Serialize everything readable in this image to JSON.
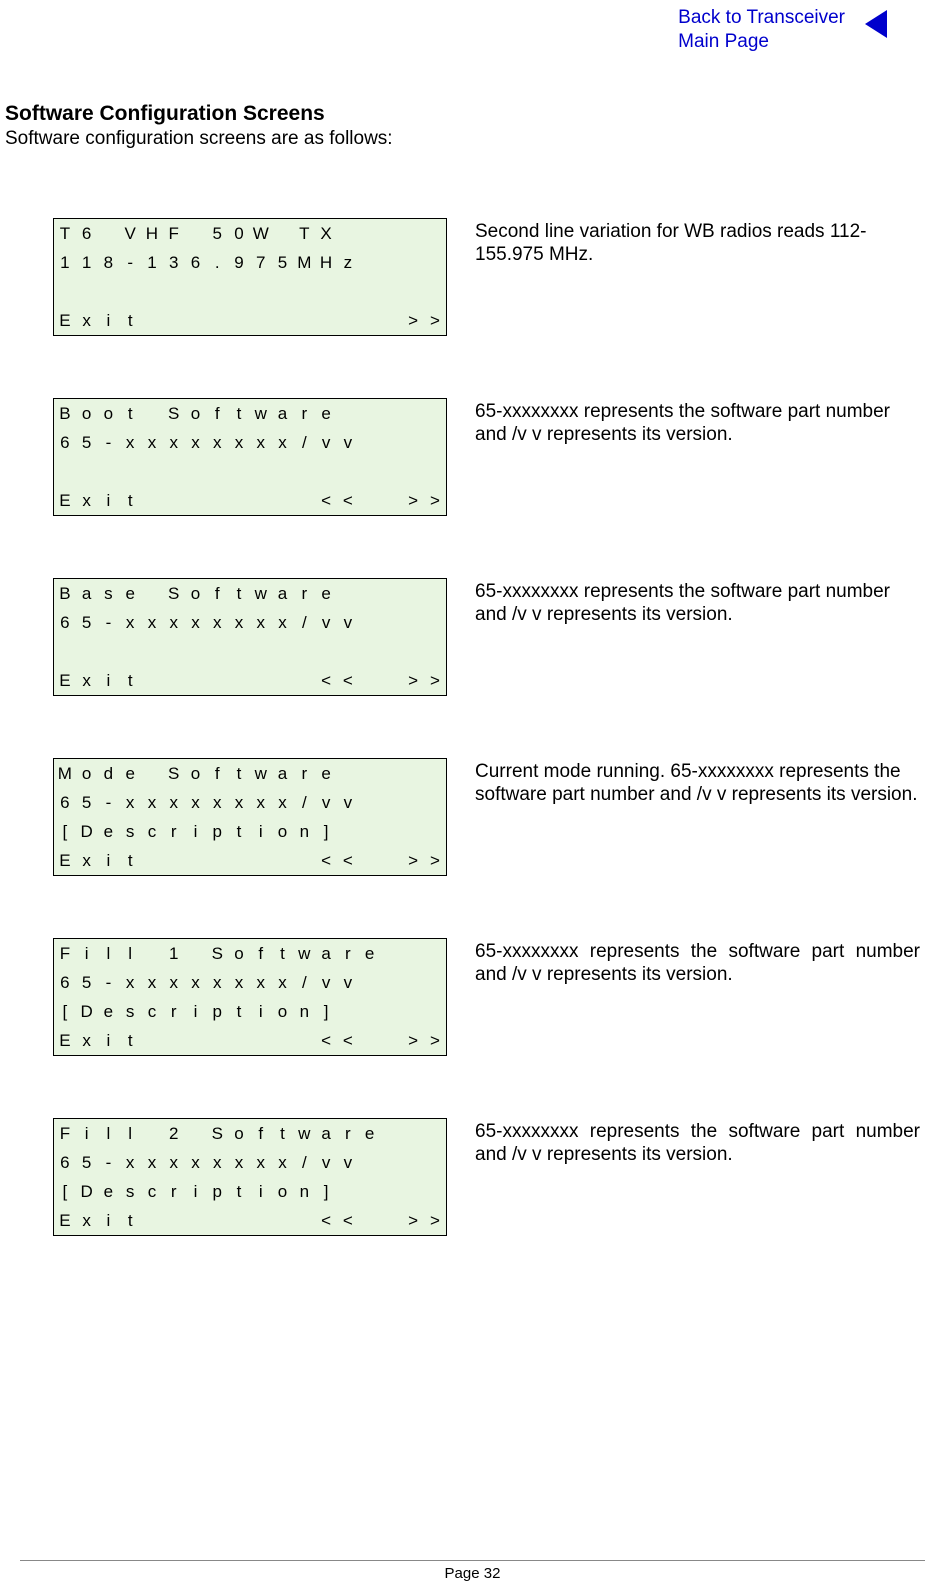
{
  "header": {
    "back_line1": "Back to Transceiver",
    "back_line2": "Main Page"
  },
  "title": "Software Configuration Screens",
  "subtitle": "Software configuration screens are as follows:",
  "screens": [
    {
      "rows": [
        [
          "T",
          "6",
          "",
          "V",
          "H",
          "F",
          "",
          "5",
          "0",
          "W",
          "",
          "T",
          "X",
          "",
          "",
          "",
          "",
          ""
        ],
        [
          "1",
          "1",
          "8",
          "-",
          "1",
          "3",
          "6",
          ".",
          "9",
          "7",
          "5",
          "M",
          "H",
          "z",
          "",
          "",
          "",
          ""
        ],
        [
          "",
          "",
          "",
          "",
          "",
          "",
          "",
          "",
          "",
          "",
          "",
          "",
          "",
          "",
          "",
          "",
          "",
          ""
        ],
        [
          "E",
          "x",
          "i",
          "t",
          "",
          "",
          "",
          "",
          "",
          "",
          "",
          "",
          "",
          "",
          "",
          "",
          ">",
          ">"
        ]
      ],
      "desc": "Second line variation for WB radios reads 112-155.975 MHz."
    },
    {
      "rows": [
        [
          "B",
          "o",
          "o",
          "t",
          "",
          "S",
          "o",
          "f",
          "t",
          "w",
          "a",
          "r",
          "e",
          "",
          "",
          "",
          "",
          ""
        ],
        [
          "6",
          "5",
          "-",
          "x",
          "x",
          "x",
          "x",
          "x",
          "x",
          "x",
          "x",
          "/",
          "v",
          "v",
          "",
          "",
          "",
          ""
        ],
        [
          "",
          "",
          "",
          "",
          "",
          "",
          "",
          "",
          "",
          "",
          "",
          "",
          "",
          "",
          "",
          "",
          "",
          ""
        ],
        [
          "E",
          "x",
          "i",
          "t",
          "",
          "",
          "",
          "",
          "",
          "",
          "",
          "",
          "<",
          "<",
          "",
          "",
          ">",
          ">"
        ]
      ],
      "desc": "65-xxxxxxxx represents the software part number and /v v represents its version."
    },
    {
      "rows": [
        [
          "B",
          "a",
          "s",
          "e",
          "",
          "S",
          "o",
          "f",
          "t",
          "w",
          "a",
          "r",
          "e",
          "",
          "",
          "",
          "",
          ""
        ],
        [
          "6",
          "5",
          "-",
          "x",
          "x",
          "x",
          "x",
          "x",
          "x",
          "x",
          "x",
          "/",
          "v",
          "v",
          "",
          "",
          "",
          ""
        ],
        [
          "",
          "",
          "",
          "",
          "",
          "",
          "",
          "",
          "",
          "",
          "",
          "",
          "",
          "",
          "",
          "",
          "",
          ""
        ],
        [
          "E",
          "x",
          "i",
          "t",
          "",
          "",
          "",
          "",
          "",
          "",
          "",
          "",
          "<",
          "<",
          "",
          "",
          ">",
          ">"
        ]
      ],
      "desc": "65-xxxxxxxx represents the software part number and /v v represents its version."
    },
    {
      "rows": [
        [
          "M",
          "o",
          "d",
          "e",
          "",
          "S",
          "o",
          "f",
          "t",
          "w",
          "a",
          "r",
          "e",
          "",
          "",
          "",
          "",
          ""
        ],
        [
          "6",
          "5",
          "-",
          "x",
          "x",
          "x",
          "x",
          "x",
          "x",
          "x",
          "x",
          "/",
          "v",
          "v",
          "",
          "",
          "",
          ""
        ],
        [
          "[",
          "D",
          "e",
          "s",
          "c",
          "r",
          "i",
          "p",
          "t",
          "i",
          "o",
          "n",
          "]",
          "",
          "",
          "",
          "",
          ""
        ],
        [
          "E",
          "x",
          "i",
          "t",
          "",
          "",
          "",
          "",
          "",
          "",
          "",
          "",
          "<",
          "<",
          "",
          "",
          ">",
          ">"
        ]
      ],
      "desc": "Current mode running. 65-xxxxxxxx represents the software part number and /v v represents its version."
    },
    {
      "rows": [
        [
          "F",
          "i",
          "l",
          "l",
          "",
          "1",
          "",
          "S",
          "o",
          "f",
          "t",
          "w",
          "a",
          "r",
          "e",
          "",
          "",
          ""
        ],
        [
          "6",
          "5",
          "-",
          "x",
          "x",
          "x",
          "x",
          "x",
          "x",
          "x",
          "x",
          "/",
          "v",
          "v",
          "",
          "",
          "",
          ""
        ],
        [
          "[",
          "D",
          "e",
          "s",
          "c",
          "r",
          "i",
          "p",
          "t",
          "i",
          "o",
          "n",
          "]",
          "",
          "",
          "",
          "",
          ""
        ],
        [
          "E",
          "x",
          "i",
          "t",
          "",
          "",
          "",
          "",
          "",
          "",
          "",
          "",
          "<",
          "<",
          "",
          "",
          ">",
          ">"
        ]
      ],
      "desc": "65-xxxxxxxx represents the software part number and /v v represents its version."
    },
    {
      "rows": [
        [
          "F",
          "i",
          "l",
          "l",
          "",
          "2",
          "",
          "S",
          "o",
          "f",
          "t",
          "w",
          "a",
          "r",
          "e",
          "",
          "",
          ""
        ],
        [
          "6",
          "5",
          "-",
          "x",
          "x",
          "x",
          "x",
          "x",
          "x",
          "x",
          "x",
          "/",
          "v",
          "v",
          "",
          "",
          "",
          ""
        ],
        [
          "[",
          "D",
          "e",
          "s",
          "c",
          "r",
          "i",
          "p",
          "t",
          "i",
          "o",
          "n",
          "]",
          "",
          "",
          "",
          "",
          ""
        ],
        [
          "E",
          "x",
          "i",
          "t",
          "",
          "",
          "",
          "",
          "",
          "",
          "",
          "",
          "<",
          "<",
          "",
          "",
          ">",
          ">"
        ]
      ],
      "desc": "65-xxxxxxxx represents the software part number and /v v represents its version."
    }
  ],
  "footer": {
    "page_num": "Page 32"
  }
}
